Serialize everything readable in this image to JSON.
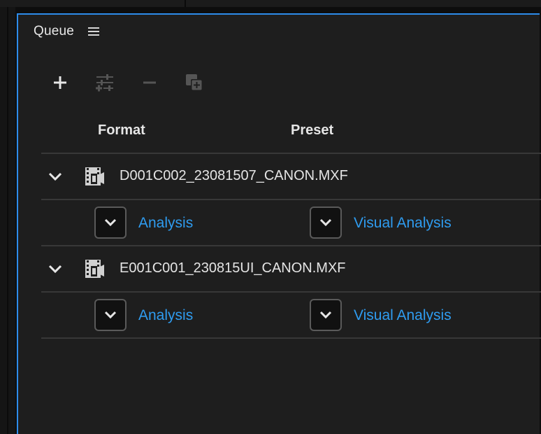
{
  "panel": {
    "title": "Queue"
  },
  "toolbar": {
    "add_icon": "plus-icon",
    "settings_icon": "sliders-icon",
    "remove_icon": "minus-icon",
    "duplicate_icon": "duplicate-icon"
  },
  "columns": {
    "format": "Format",
    "preset": "Preset"
  },
  "queue": [
    {
      "file": "D001C002_23081507_CANON.MXF",
      "format": "Analysis",
      "preset": "Visual Analysis"
    },
    {
      "file": "E001C001_230815UI_CANON.MXF",
      "format": "Analysis",
      "preset": "Visual Analysis"
    }
  ],
  "colors": {
    "accent": "#2d8ceb",
    "link": "#2f9cf0",
    "panel_bg": "#1e1e1e"
  }
}
